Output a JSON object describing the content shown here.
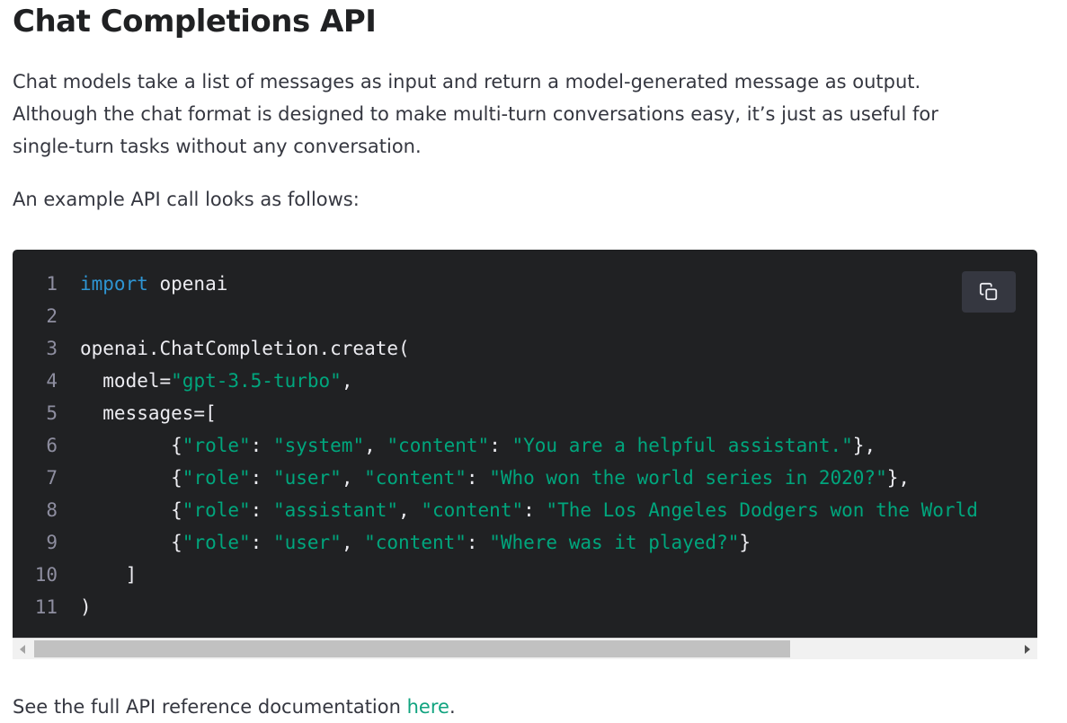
{
  "title": "Chat Completions API",
  "intro": {
    "line1": "Chat models take a list of messages as input and return a model-generated message as output.",
    "line2": "Although the chat format is designed to make multi-turn conversations easy, it’s just as useful for",
    "line3": "single-turn tasks without any conversation."
  },
  "example_lead": "An example API call looks as follows:",
  "code": {
    "lines": [
      {
        "num": "1",
        "parts": [
          {
            "t": "import",
            "c": "kw"
          },
          {
            "t": " openai",
            "c": ""
          }
        ]
      },
      {
        "num": "2",
        "parts": []
      },
      {
        "num": "3",
        "parts": [
          {
            "t": "openai.ChatCompletion.create(",
            "c": ""
          }
        ]
      },
      {
        "num": "4",
        "parts": [
          {
            "t": "  model=",
            "c": ""
          },
          {
            "t": "\"gpt-3.5-turbo\"",
            "c": "str"
          },
          {
            "t": ",",
            "c": ""
          }
        ]
      },
      {
        "num": "5",
        "parts": [
          {
            "t": "  messages=[",
            "c": ""
          }
        ]
      },
      {
        "num": "6",
        "parts": [
          {
            "t": "        {",
            "c": ""
          },
          {
            "t": "\"role\"",
            "c": "str"
          },
          {
            "t": ": ",
            "c": ""
          },
          {
            "t": "\"system\"",
            "c": "str"
          },
          {
            "t": ", ",
            "c": ""
          },
          {
            "t": "\"content\"",
            "c": "str"
          },
          {
            "t": ": ",
            "c": ""
          },
          {
            "t": "\"You are a helpful assistant.\"",
            "c": "str"
          },
          {
            "t": "},",
            "c": ""
          }
        ]
      },
      {
        "num": "7",
        "parts": [
          {
            "t": "        {",
            "c": ""
          },
          {
            "t": "\"role\"",
            "c": "str"
          },
          {
            "t": ": ",
            "c": ""
          },
          {
            "t": "\"user\"",
            "c": "str"
          },
          {
            "t": ", ",
            "c": ""
          },
          {
            "t": "\"content\"",
            "c": "str"
          },
          {
            "t": ": ",
            "c": ""
          },
          {
            "t": "\"Who won the world series in 2020?\"",
            "c": "str"
          },
          {
            "t": "},",
            "c": ""
          }
        ]
      },
      {
        "num": "8",
        "parts": [
          {
            "t": "        {",
            "c": ""
          },
          {
            "t": "\"role\"",
            "c": "str"
          },
          {
            "t": ": ",
            "c": ""
          },
          {
            "t": "\"assistant\"",
            "c": "str"
          },
          {
            "t": ", ",
            "c": ""
          },
          {
            "t": "\"content\"",
            "c": "str"
          },
          {
            "t": ": ",
            "c": ""
          },
          {
            "t": "\"The Los Angeles Dodgers won the World",
            "c": "str"
          }
        ]
      },
      {
        "num": "9",
        "parts": [
          {
            "t": "        {",
            "c": ""
          },
          {
            "t": "\"role\"",
            "c": "str"
          },
          {
            "t": ": ",
            "c": ""
          },
          {
            "t": "\"user\"",
            "c": "str"
          },
          {
            "t": ", ",
            "c": ""
          },
          {
            "t": "\"content\"",
            "c": "str"
          },
          {
            "t": ": ",
            "c": ""
          },
          {
            "t": "\"Where was it played?\"",
            "c": "str"
          },
          {
            "t": "}",
            "c": ""
          }
        ]
      },
      {
        "num": "10",
        "parts": [
          {
            "t": "    ]",
            "c": ""
          }
        ]
      },
      {
        "num": "11",
        "parts": [
          {
            "t": ")",
            "c": ""
          }
        ]
      }
    ],
    "copy_icon": "copy-icon"
  },
  "scrollbar": {
    "thumb_fraction": 0.77
  },
  "footer": {
    "prefix": "See the full API reference documentation ",
    "link_text": "here",
    "suffix": "."
  },
  "colors": {
    "code_bg": "#202123",
    "keyword": "#2e95d3",
    "string": "#00a67d",
    "link": "#10a37f"
  }
}
